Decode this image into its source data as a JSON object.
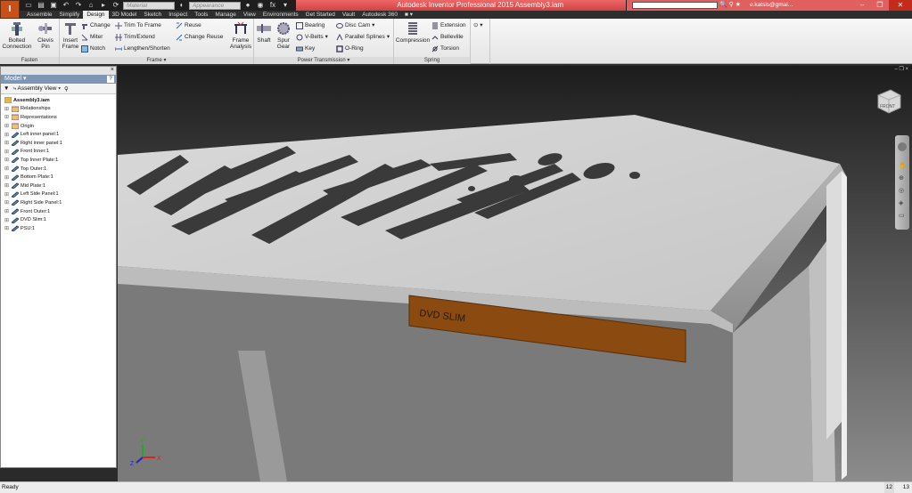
{
  "app": {
    "title": "Autodesk Inventor Professional 2015   Assembly3.iam",
    "app_button": "I",
    "material_placeholder": "Material",
    "appearance_placeholder": "Appearance",
    "user": "e.katsis@gmai...",
    "accent": "#c8511a"
  },
  "tabs": [
    "Assemble",
    "Simplify",
    "Design",
    "3D Model",
    "Sketch",
    "Inspect",
    "Tools",
    "Manage",
    "View",
    "Environments",
    "Get Started",
    "Vault",
    "Autodesk 360",
    "■ ▾"
  ],
  "active_tab": "Design",
  "ribbon": {
    "fasten": {
      "label": "Fasten",
      "bolted": "Bolted\nConnection",
      "clevis": "Clevis\nPin"
    },
    "frame": {
      "label": "Frame ▾",
      "insert": "Insert\nFrame",
      "change": "Change",
      "miter": "Miter",
      "notch": "Notch",
      "trim_to_frame": "Trim To Frame",
      "trim_extend": "Trim/Extend",
      "lengthen": "Lengthen/Shorten",
      "reuse": "Reuse",
      "change_reuse": "Change Reuse",
      "analysis": "Frame\nAnalysis"
    },
    "power": {
      "label": "Power Transmission ▾",
      "shaft": "Shaft",
      "spur": "Spur\nGear",
      "bearing": "Bearing",
      "vbelts": "V-Belts",
      "key": "Key",
      "disc_cam": "Disc Cam",
      "parallel_splines": "Parallel Splines",
      "oring": "O-Ring"
    },
    "spring": {
      "label": "Spring",
      "compression": "Compression",
      "extension": "Extension",
      "belleville": "Belleville",
      "torsion": "Torsion"
    }
  },
  "browser": {
    "title": "Model ▾",
    "help": "?",
    "view_label": "Assembly View",
    "root": "Assembly3.iam",
    "items": [
      "Relationships",
      "Representations",
      "Origin",
      "Left inner panel:1",
      "Right inner panel:1",
      "Front Inner:1",
      "Top Inner Plate:1",
      "Top Outer:1",
      "Bottom Plate:1",
      "Mid Plate:1",
      "Left Side Panel:1",
      "Right Side Panel:1",
      "Front Outer:1",
      "DVD Slim:1",
      "PSU:1"
    ]
  },
  "viewport": {
    "label_text": "DVD SLIM",
    "viewcube_face": "FRONT",
    "label_color": "#8a4a10"
  },
  "status": {
    "text": "Ready",
    "count1": "12",
    "count2": "13"
  }
}
